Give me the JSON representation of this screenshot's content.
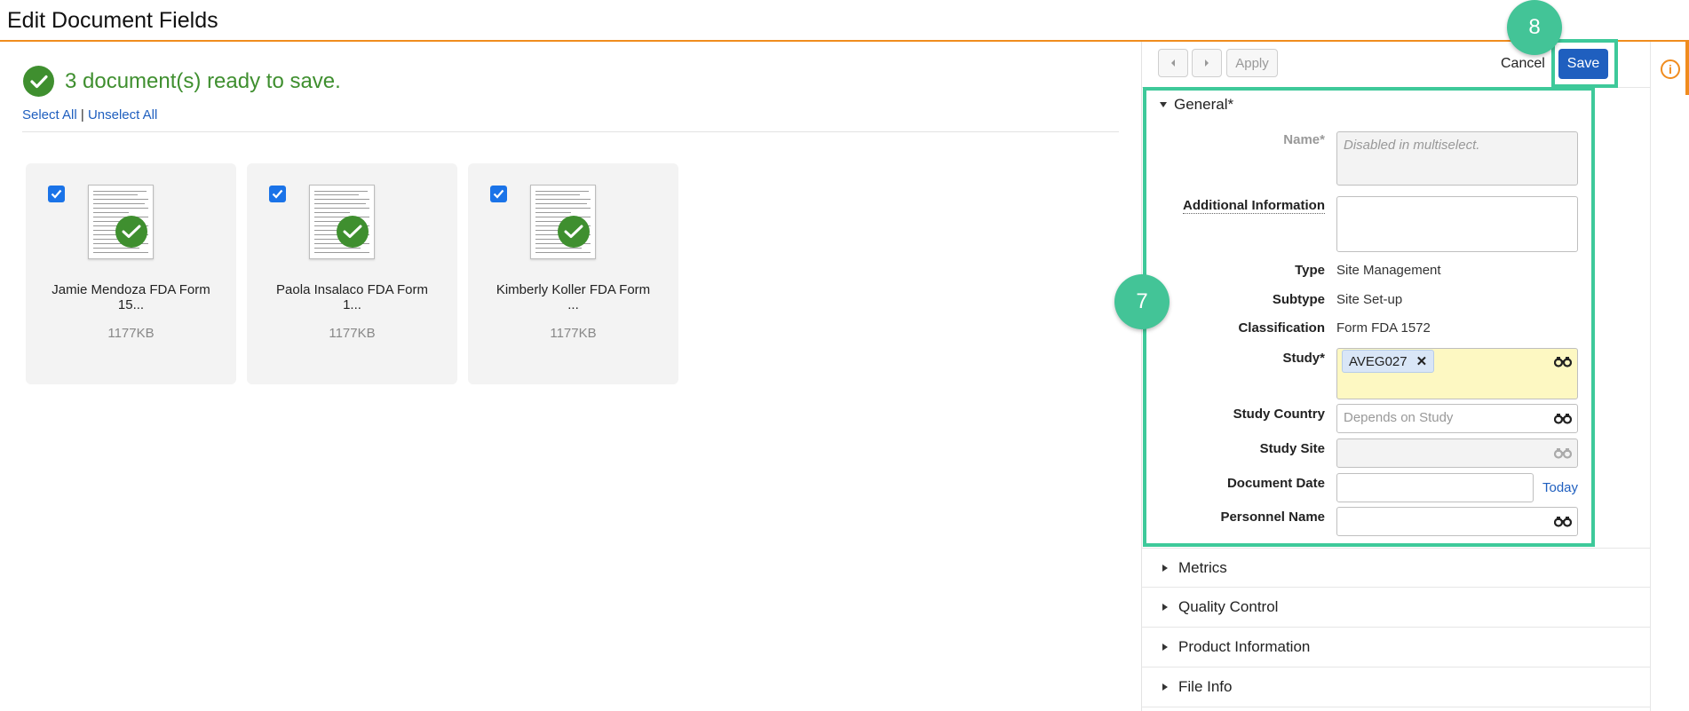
{
  "header": {
    "title": "Edit Document Fields"
  },
  "status": {
    "message": "3 document(s) ready to save."
  },
  "selection": {
    "select_all": "Select All",
    "separator": "|",
    "unselect_all": "Unselect All"
  },
  "documents": [
    {
      "name_line1": "Jamie Mendoza FDA Form",
      "name_line2": "15...",
      "size": "1177KB",
      "checked": true
    },
    {
      "name_line1": "Paola Insalaco FDA Form",
      "name_line2": "1...",
      "size": "1177KB",
      "checked": true
    },
    {
      "name_line1": "Kimberly Koller FDA Form",
      "name_line2": "...",
      "size": "1177KB",
      "checked": true
    }
  ],
  "toolbar": {
    "apply": "Apply",
    "cancel": "Cancel",
    "save": "Save"
  },
  "callouts": {
    "general": "7",
    "save": "8"
  },
  "general": {
    "title": "General*",
    "name_label": "Name*",
    "name_placeholder": "Disabled in multiselect.",
    "additional_info_label": "Additional Information",
    "type_label": "Type",
    "type_value": "Site Management",
    "subtype_label": "Subtype",
    "subtype_value": "Site Set-up",
    "classification_label": "Classification",
    "classification_value": "Form FDA 1572",
    "study_label": "Study*",
    "study_tag": "AVEG027",
    "study_country_label": "Study Country",
    "study_country_placeholder": "Depends on Study",
    "study_site_label": "Study Site",
    "document_date_label": "Document Date",
    "today_link": "Today",
    "personnel_name_label": "Personnel Name"
  },
  "sections": [
    {
      "label": "Metrics"
    },
    {
      "label": "Quality Control"
    },
    {
      "label": "Product Information"
    },
    {
      "label": "File Info"
    }
  ],
  "colors": {
    "accent": "#f08c1e",
    "success": "#3f8f2f",
    "primary": "#1f5fbf",
    "highlight": "#3ec99a"
  },
  "icons": {
    "info": "info-icon",
    "lookup": "binoculars-icon"
  }
}
